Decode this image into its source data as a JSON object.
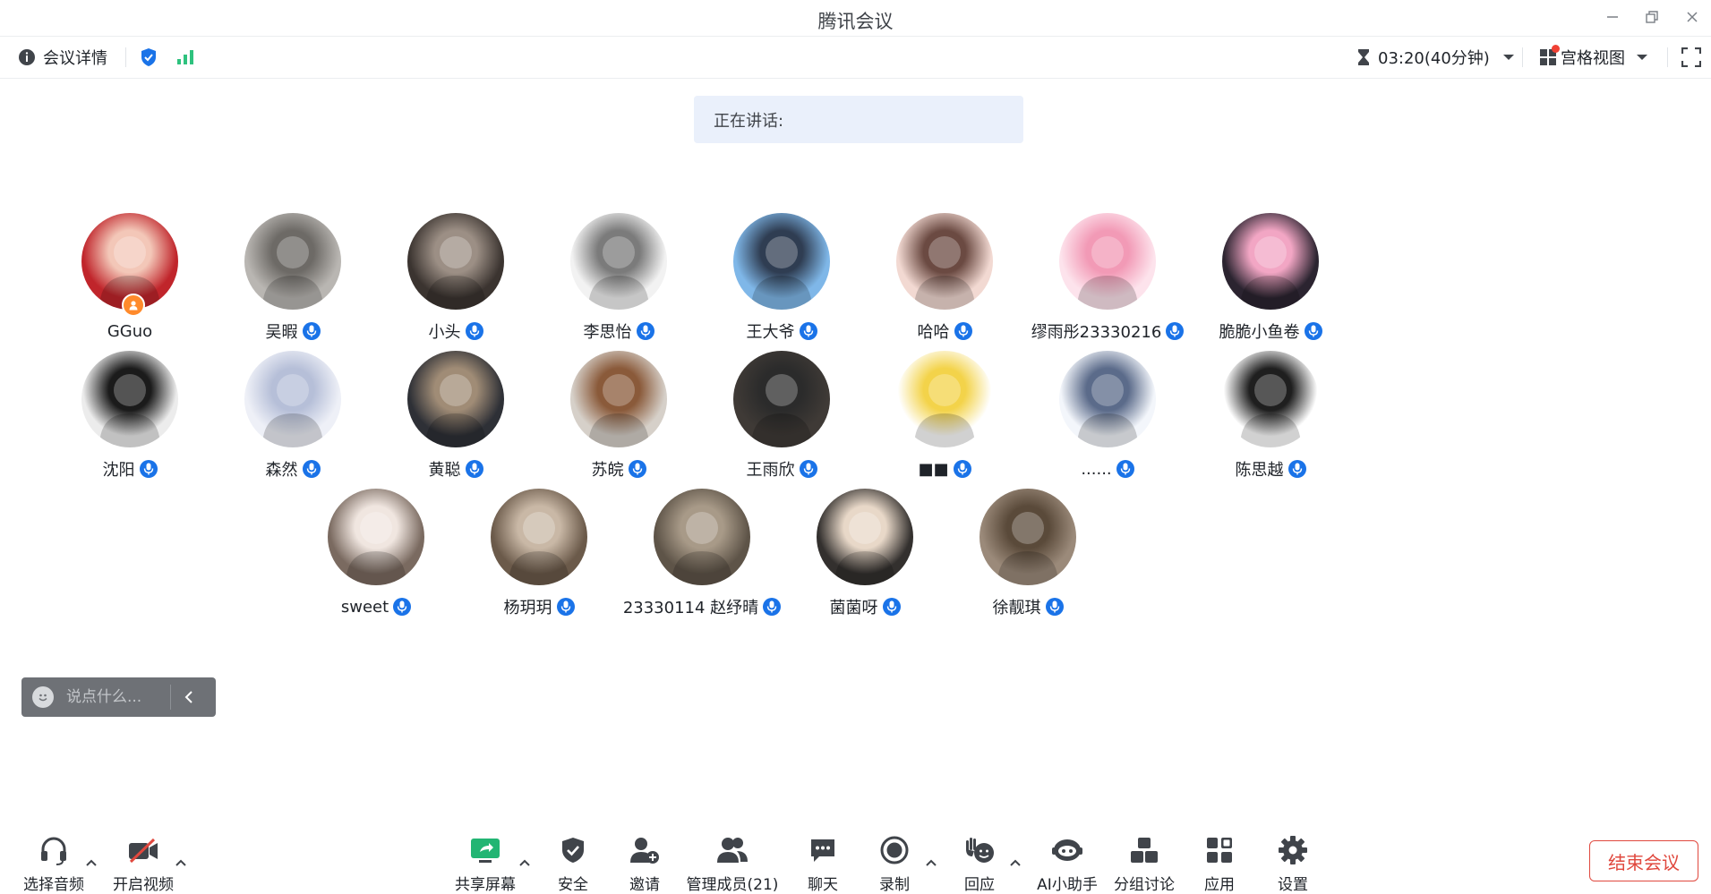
{
  "window": {
    "title": "腾讯会议"
  },
  "infobar": {
    "meeting_info_label": "会议详情",
    "timer": "03:20(40分钟)",
    "view_mode": "宫格视图"
  },
  "speaking": {
    "label": "正在讲话:"
  },
  "participants": [
    {
      "name": "GGuo",
      "host": true
    },
    {
      "name": "吴暇"
    },
    {
      "name": "小头"
    },
    {
      "name": "李思怡"
    },
    {
      "name": "王大爷"
    },
    {
      "name": "哈哈"
    },
    {
      "name": "缪雨彤23330216"
    },
    {
      "name": "脆脆小鱼卷"
    },
    {
      "name": "沈阳"
    },
    {
      "name": "森然"
    },
    {
      "name": "黄聪"
    },
    {
      "name": "苏皖"
    },
    {
      "name": "王雨欣"
    },
    {
      "name": "■■"
    },
    {
      "name": "......"
    },
    {
      "name": "陈思越"
    },
    {
      "name": "sweet"
    },
    {
      "name": "杨玥玥"
    },
    {
      "name": "23330114 赵纾晴"
    },
    {
      "name": "菌菌呀"
    },
    {
      "name": "徐靓琪"
    }
  ],
  "chat": {
    "placeholder": "说点什么..."
  },
  "toolbar": {
    "audio": "选择音频",
    "video": "开启视频",
    "share": "共享屏幕",
    "security": "安全",
    "invite": "邀请",
    "members": "管理成员(21)",
    "chat": "聊天",
    "record": "录制",
    "react": "回应",
    "ai": "AI小助手",
    "breakout": "分组讨论",
    "apps": "应用",
    "settings": "设置",
    "end": "结束会议"
  },
  "colors": {
    "accent_blue": "#1a73e8",
    "end_red": "#e0483e",
    "host_orange": "#ff8a2b",
    "signal_green": "#2ec27e",
    "share_green": "#22b573"
  }
}
